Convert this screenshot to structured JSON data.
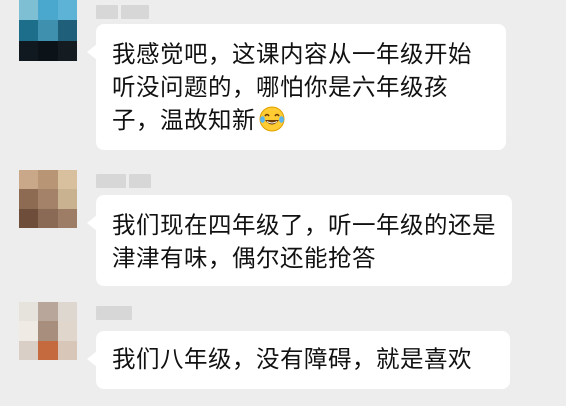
{
  "chat": {
    "messages": [
      {
        "text": "我感觉吧，这课内容从一年级开始听没问题的，哪怕你是六年级孩子，温故知新",
        "emoji": "tears-of-joy-emoji"
      },
      {
        "text": "我们现在四年级了，听一年级的还是津津有味，偶尔还能抢答"
      },
      {
        "text": "我们八年级，没有障碍，就是喜欢"
      }
    ]
  }
}
